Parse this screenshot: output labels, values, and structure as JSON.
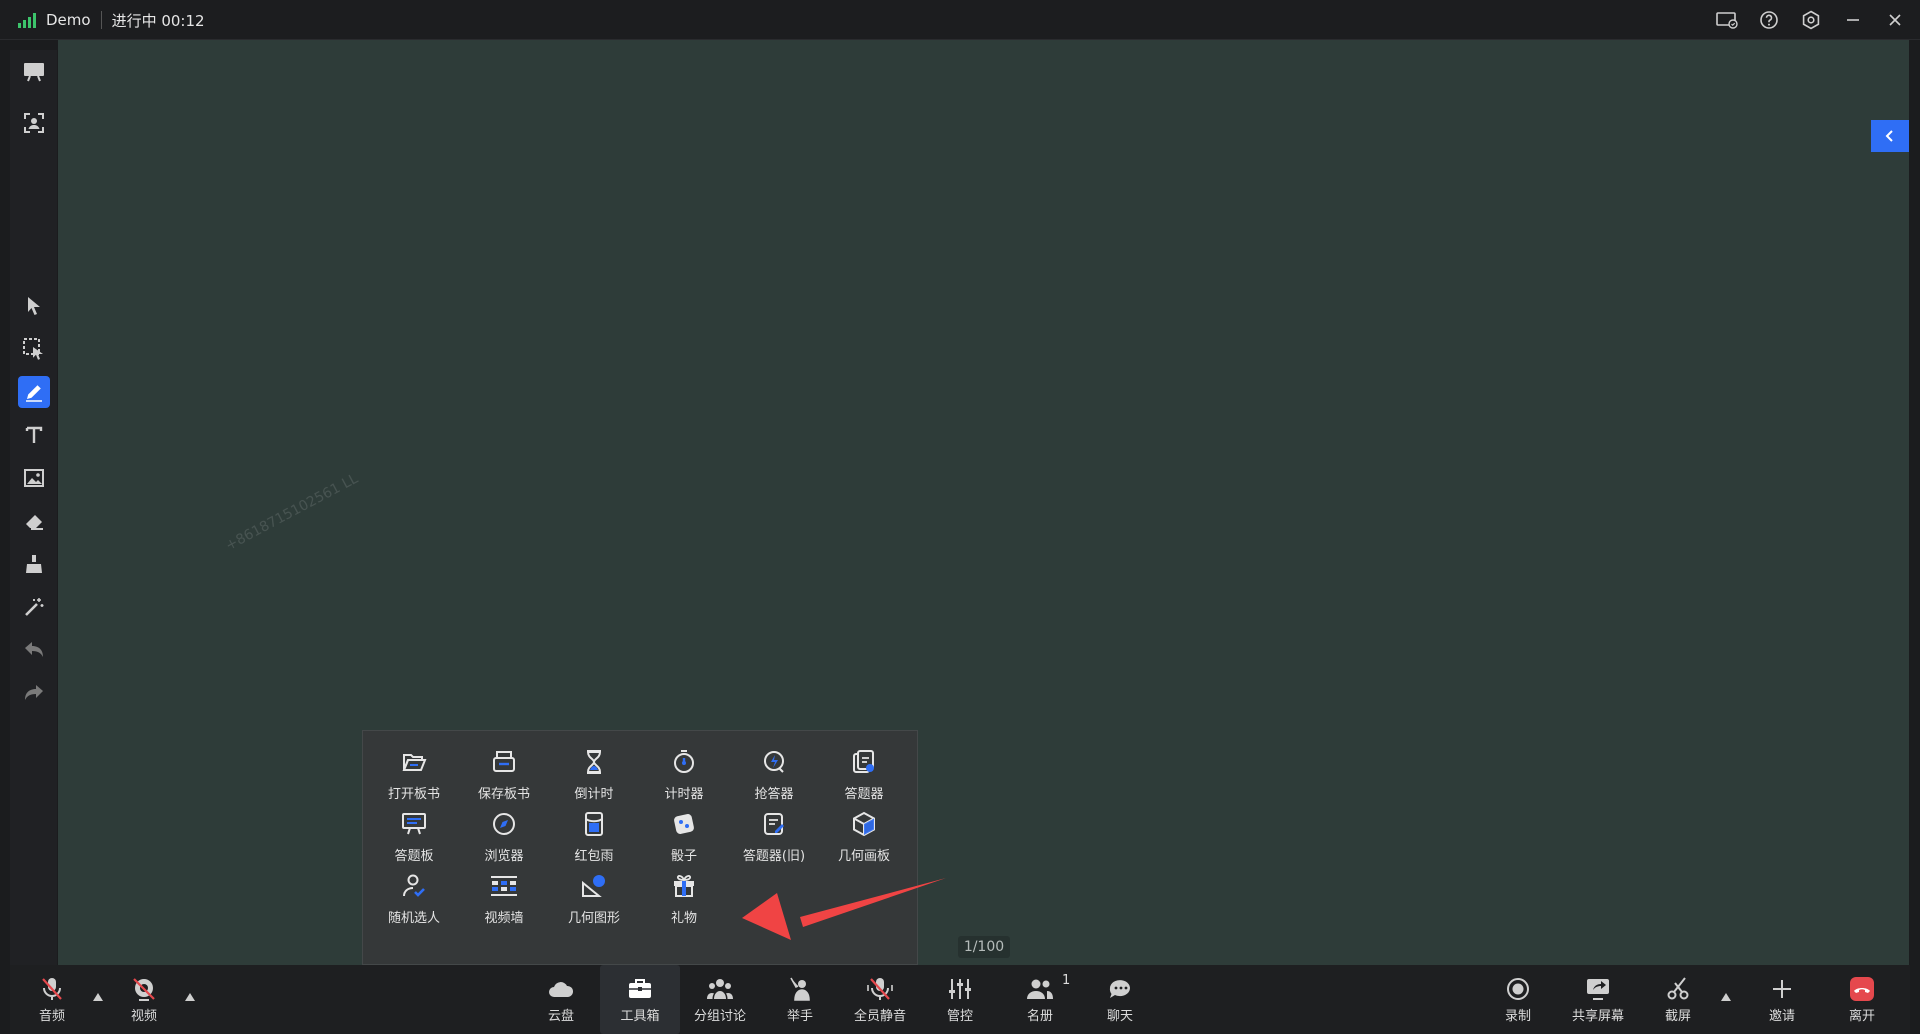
{
  "titlebar": {
    "app_name": "Demo",
    "status": "进行中 00:12"
  },
  "board": {
    "watermark": "+8618715102561 LL",
    "page_indicator": "1/100"
  },
  "toolbox": {
    "items": [
      {
        "label": "打开板书",
        "icon": "folder-open-icon"
      },
      {
        "label": "保存板书",
        "icon": "save-board-icon"
      },
      {
        "label": "倒计时",
        "icon": "hourglass-icon"
      },
      {
        "label": "计时器",
        "icon": "stopwatch-icon"
      },
      {
        "label": "抢答器",
        "icon": "buzzer-icon"
      },
      {
        "label": "答题器",
        "icon": "answer-sheet-icon"
      },
      {
        "label": "答题板",
        "icon": "answer-board-icon"
      },
      {
        "label": "浏览器",
        "icon": "compass-icon"
      },
      {
        "label": "红包雨",
        "icon": "red-packet-icon"
      },
      {
        "label": "骰子",
        "icon": "dice-icon"
      },
      {
        "label": "答题器(旧)",
        "icon": "answer-sheet-old-icon"
      },
      {
        "label": "几何画板",
        "icon": "cube-icon"
      },
      {
        "label": "随机选人",
        "icon": "random-person-icon"
      },
      {
        "label": "视频墙",
        "icon": "video-wall-icon"
      },
      {
        "label": "几何图形",
        "icon": "geometry-shape-icon"
      },
      {
        "label": "礼物",
        "icon": "gift-icon"
      }
    ]
  },
  "bottombar": {
    "audio": "音频",
    "video": "视频",
    "cloud": "云盘",
    "toolbox": "工具箱",
    "group": "分组讨论",
    "raise_hand": "举手",
    "mute_all": "全员静音",
    "control": "管控",
    "roster": "名册",
    "roster_count": "1",
    "chat": "聊天",
    "record": "录制",
    "share_screen": "共享屏幕",
    "screenshot": "截屏",
    "invite": "邀请",
    "leave": "离开"
  },
  "colors": {
    "board_bg": "#2e3c39",
    "accent": "#2f6ef5",
    "leave_red": "#e5484d",
    "arrow_red": "#f04444",
    "signal_green": "#3cc46b"
  }
}
